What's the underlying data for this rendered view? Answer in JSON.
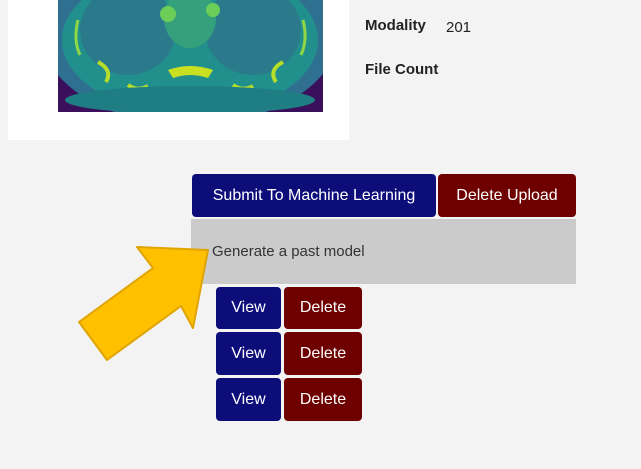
{
  "metadata": {
    "modality_label": "Modality",
    "modality_value": "201",
    "file_count_label": "File Count",
    "file_count_value": ""
  },
  "actions": {
    "submit_label": "Submit To Machine Learning",
    "delete_upload_label": "Delete Upload"
  },
  "generate_panel": {
    "text": "Generate a past model"
  },
  "models": [
    {
      "view_label": "View",
      "delete_label": "Delete"
    },
    {
      "view_label": "View",
      "delete_label": "Delete"
    },
    {
      "view_label": "View",
      "delete_label": "Delete"
    }
  ],
  "colors": {
    "primary_button": "#0d0d7a",
    "danger_button": "#6e0000",
    "panel": "#cbcbcb",
    "arrow": "#ffc000"
  },
  "icons": {
    "annotation_arrow": "arrow-pointing-right-icon"
  }
}
